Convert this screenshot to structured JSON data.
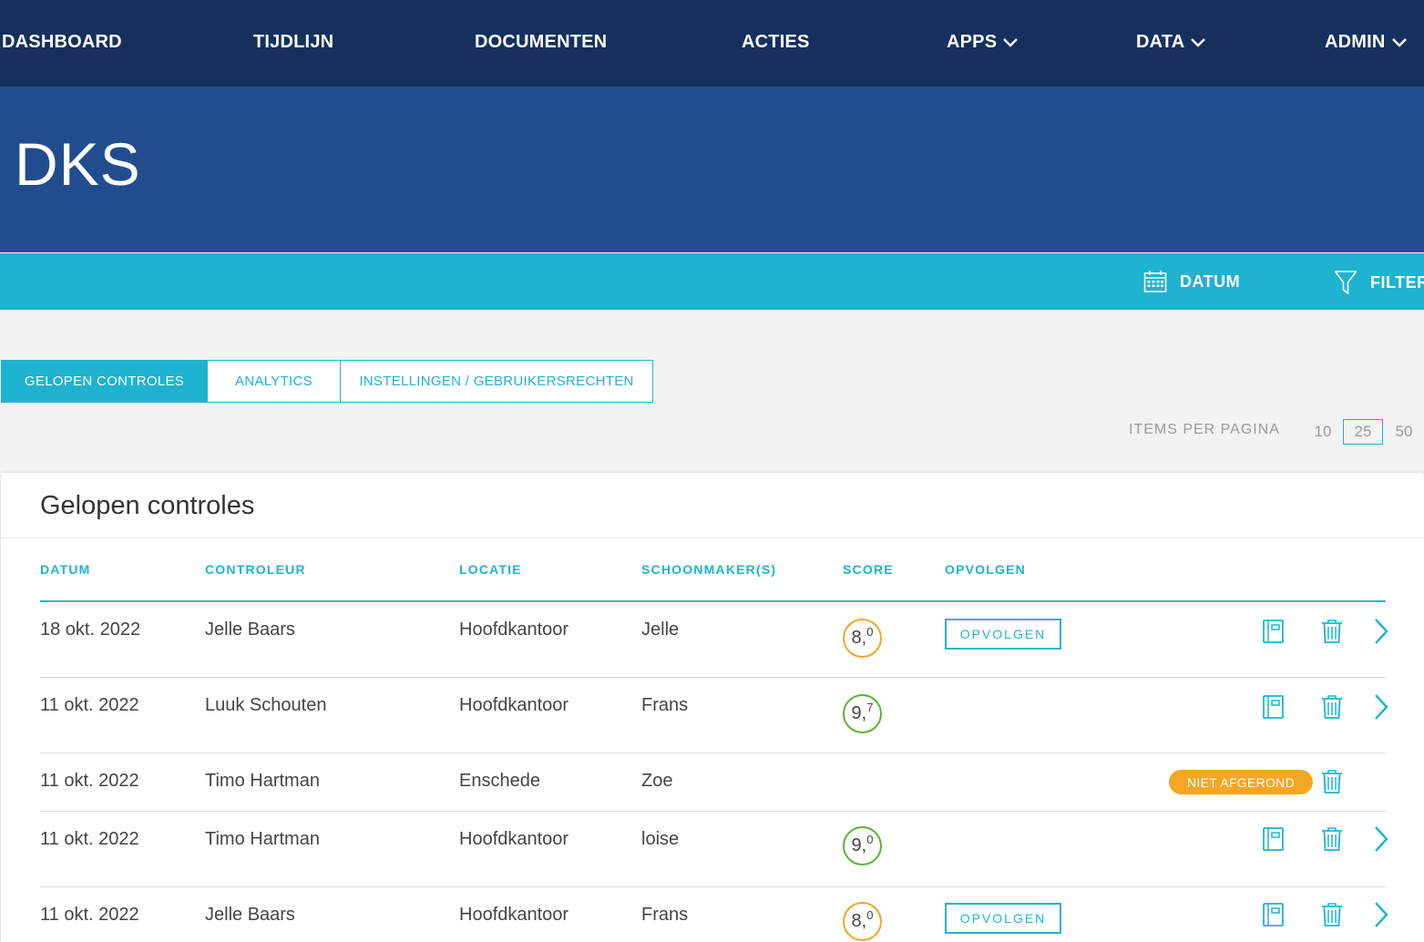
{
  "nav": {
    "items": [
      {
        "label": "DASHBOARD",
        "dropdown": false
      },
      {
        "label": "TIJDLIJN",
        "dropdown": false
      },
      {
        "label": "DOCUMENTEN",
        "dropdown": false
      },
      {
        "label": "ACTIES",
        "dropdown": false
      },
      {
        "label": "APPS",
        "dropdown": true
      },
      {
        "label": "DATA",
        "dropdown": true
      },
      {
        "label": "ADMIN",
        "dropdown": true
      }
    ]
  },
  "banner": {
    "title": "DKS"
  },
  "toolbar": {
    "datum_label": "DATUM",
    "filter_label": "FILTER"
  },
  "tabs": [
    {
      "label": "GELOPEN CONTROLES",
      "active": true
    },
    {
      "label": "ANALYTICS",
      "active": false
    },
    {
      "label": "INSTELLINGEN / GEBRUIKERSRECHTEN",
      "active": false
    }
  ],
  "pagination": {
    "label": "ITEMS PER PAGINA",
    "options": [
      "10",
      "25",
      "50"
    ],
    "selected": "25"
  },
  "table": {
    "title": "Gelopen controles",
    "columns": [
      "DATUM",
      "CONTROLEUR",
      "LOCATIE",
      "SCHOONMAKER(S)",
      "SCORE",
      "OPVOLGEN"
    ],
    "rows": [
      {
        "date": "18 okt. 2022",
        "controller": "Jelle Baars",
        "location": "Hoofdkantoor",
        "cleaner": "Jelle",
        "score_int": "8,",
        "score_dec": "0",
        "score_color": "#f5a623",
        "follow_up": "OPVOLGEN",
        "status": "",
        "has_detail": true
      },
      {
        "date": "11 okt. 2022",
        "controller": "Luuk Schouten",
        "location": "Hoofdkantoor",
        "cleaner": "Frans",
        "score_int": "9,",
        "score_dec": "7",
        "score_color": "#5cb531",
        "follow_up": "",
        "status": "",
        "has_detail": true
      },
      {
        "date": "11 okt. 2022",
        "controller": "Timo Hartman",
        "location": "Enschede",
        "cleaner": "Zoe",
        "score_int": "",
        "score_dec": "",
        "score_color": "",
        "follow_up": "",
        "status": "NIET AFGEROND",
        "has_detail": false
      },
      {
        "date": "11 okt. 2022",
        "controller": "Timo Hartman",
        "location": "Hoofdkantoor",
        "cleaner": "loise",
        "score_int": "9,",
        "score_dec": "0",
        "score_color": "#5cb531",
        "follow_up": "",
        "status": "",
        "has_detail": true
      },
      {
        "date": "11 okt. 2022",
        "controller": "Jelle Baars",
        "location": "Hoofdkantoor",
        "cleaner": "Frans",
        "score_int": "8,",
        "score_dec": "0",
        "score_color": "#f5a623",
        "follow_up": "OPVOLGEN",
        "status": "",
        "has_detail": true
      }
    ]
  },
  "colors": {
    "nav_bg": "#15305c",
    "banner_bg": "#214d8f",
    "accent": "#1eb3d0",
    "warning": "#f5a623",
    "success": "#5cb531"
  },
  "icons": [
    "chevron-down-icon",
    "calendar-icon",
    "filter-icon",
    "report-icon",
    "trash-icon",
    "chevron-right-icon"
  ]
}
